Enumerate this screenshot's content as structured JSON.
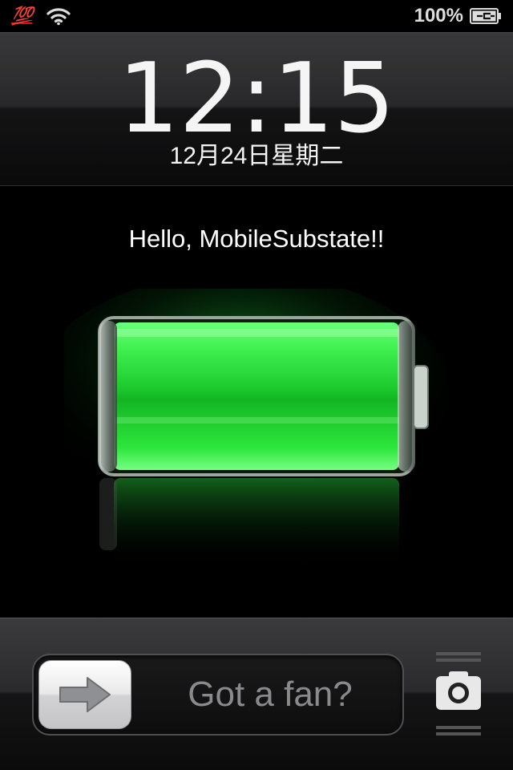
{
  "status_bar": {
    "carrier_badge": "💯",
    "battery_percent": "100%",
    "icons": [
      "hundred-points-icon",
      "wifi-icon",
      "battery-charging-icon"
    ]
  },
  "clock": {
    "time": "12:15",
    "date": "12月24日星期二"
  },
  "message": "Hello, MobileSubstate!!",
  "battery": {
    "charge_fraction": 1.0,
    "color": "#27e03a"
  },
  "slider": {
    "label": "Got a fan?",
    "knob_icon": "right-arrow-icon"
  },
  "camera": {
    "icon": "camera-icon"
  }
}
